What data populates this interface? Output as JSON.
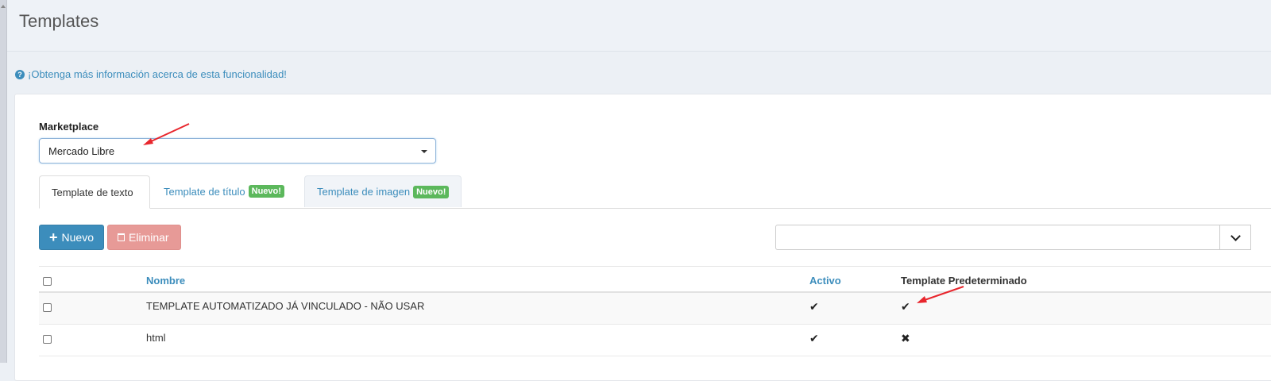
{
  "header": {
    "title": "Templates"
  },
  "info": {
    "icon": "question-circle-icon",
    "text": "¡Obtenga más información acerca de esta funcionalidad!"
  },
  "marketplace": {
    "label": "Marketplace",
    "value": "Mercado Libre"
  },
  "tabs": [
    {
      "label": "Template de texto",
      "badge": "",
      "active": true
    },
    {
      "label": "Template de título",
      "badge": "Nuevo!",
      "active": false
    },
    {
      "label": "Template de imagen",
      "badge": "Nuevo!",
      "active": false
    }
  ],
  "toolbar": {
    "new_label": "Nuevo",
    "delete_label": "Eliminar",
    "search_value": ""
  },
  "table": {
    "columns": {
      "name": "Nombre",
      "active": "Activo",
      "default": "Template Predeterminado"
    },
    "rows": [
      {
        "name": "TEMPLATE AUTOMATIZADO JÁ VINCULADO - NÃO USAR",
        "active": "✔",
        "default": "✔"
      },
      {
        "name": "html",
        "active": "✔",
        "default": "✖"
      }
    ]
  },
  "colors": {
    "primary": "#3c8dbc",
    "danger_light": "#e79a97",
    "badge_green": "#5cb85c",
    "arrow_red": "#e8262d"
  }
}
